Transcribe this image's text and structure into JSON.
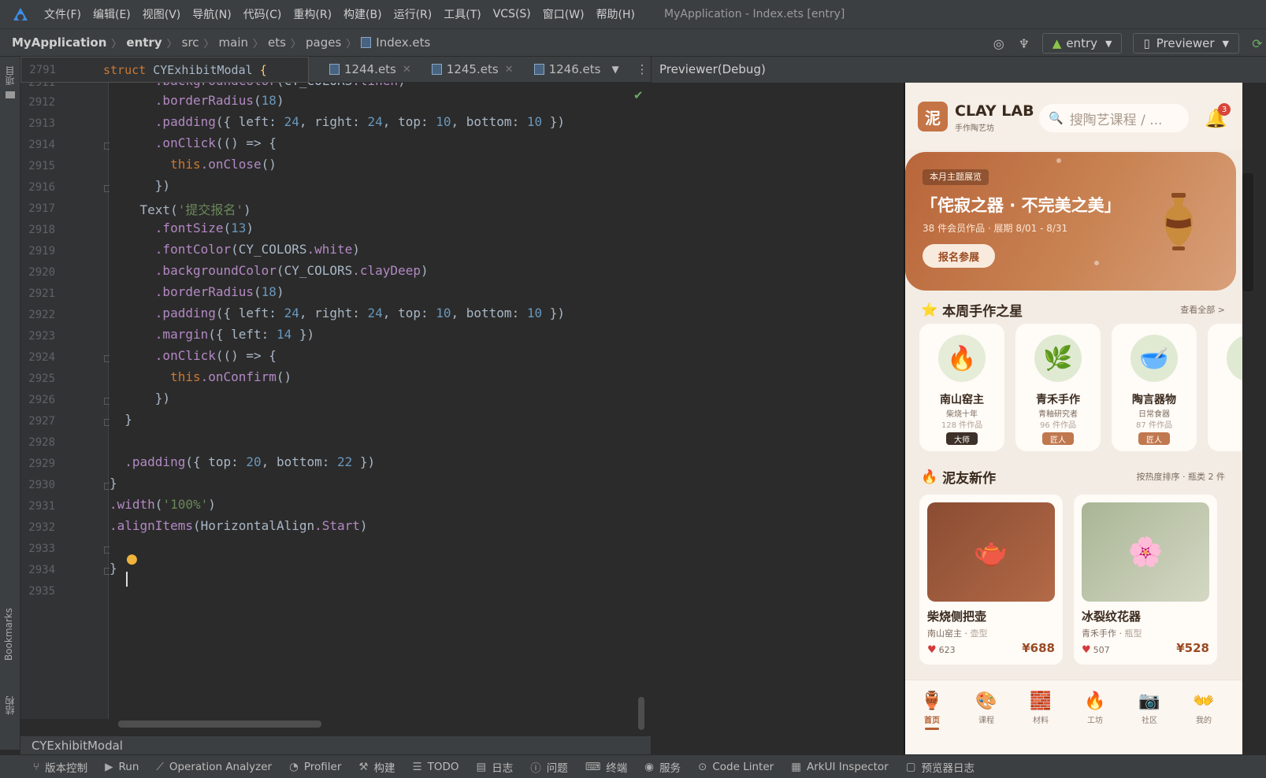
{
  "menubar": {
    "items": [
      "文件(F)",
      "编辑(E)",
      "视图(V)",
      "导航(N)",
      "代码(C)",
      "重构(R)",
      "构建(B)",
      "运行(R)",
      "工具(T)",
      "VCS(S)",
      "窗口(W)",
      "帮助(H)"
    ],
    "window_title": "MyApplication - Index.ets [entry]"
  },
  "breadcrumb": {
    "items": [
      "MyApplication",
      "entry",
      "src",
      "main",
      "ets",
      "pages",
      "Index.ets"
    ]
  },
  "toolbar": {
    "module": "entry",
    "previewer": "Previewer"
  },
  "left_tool_window": {
    "project": "项目",
    "bookmarks": "Bookmarks",
    "structure": "结构"
  },
  "editor_tabs": [
    "1244.ets",
    "1245.ets",
    "1246.ets"
  ],
  "sticky_header": {
    "line": "2791",
    "code": "struct CYExhibitModal {"
  },
  "editor": {
    "lines": [
      {
        "n": "2912",
        "code": "      .borderRadius(18)"
      },
      {
        "n": "2913",
        "code": "      .padding({ left: 24, right: 24, top: 10, bottom: 10 })"
      },
      {
        "n": "2914",
        "code": "      .onClick(() => {"
      },
      {
        "n": "2915",
        "code": "        this.onClose()"
      },
      {
        "n": "2916",
        "code": "      })"
      },
      {
        "n": "2917",
        "code": "    Text('提交报名')"
      },
      {
        "n": "2918",
        "code": "      .fontSize(13)"
      },
      {
        "n": "2919",
        "code": "      .fontColor(CY_COLORS.white)"
      },
      {
        "n": "2920",
        "code": "      .backgroundColor(CY_COLORS.clayDeep)"
      },
      {
        "n": "2921",
        "code": "      .borderRadius(18)"
      },
      {
        "n": "2922",
        "code": "      .padding({ left: 24, right: 24, top: 10, bottom: 10 })"
      },
      {
        "n": "2923",
        "code": "      .margin({ left: 14 })"
      },
      {
        "n": "2924",
        "code": "      .onClick(() => {"
      },
      {
        "n": "2925",
        "code": "        this.onConfirm()"
      },
      {
        "n": "2926",
        "code": "      })"
      },
      {
        "n": "2927",
        "code": "  }"
      },
      {
        "n": "2928",
        "code": ""
      },
      {
        "n": "2929",
        "code": "  .padding({ top: 20, bottom: 22 })"
      },
      {
        "n": "2930",
        "code": "}"
      },
      {
        "n": "2931",
        "code": ".width('100%')"
      },
      {
        "n": "2932",
        "code": ".alignItems(HorizontalAlign.Start)"
      },
      {
        "n": "2933",
        "code": ""
      },
      {
        "n": "2934",
        "code": "}"
      },
      {
        "n": "2935",
        "code": ""
      }
    ],
    "partial_top": {
      "n": "2911",
      "code": "      .backgroundColor(CY_COLORS.linen)"
    }
  },
  "structure_bar": "CYExhibitModal",
  "previewer_header": "Previewer(Debug)",
  "statusbar": [
    "版本控制",
    "Run",
    "Operation Analyzer",
    "Profiler",
    "构建",
    "TODO",
    "日志",
    "问题",
    "终端",
    "服务",
    "Code Linter",
    "ArkUI Inspector",
    "预览器日志"
  ],
  "phone": {
    "brand_mark": "泥",
    "brand_name": "CLAY LAB",
    "brand_sub": "手作陶艺坊",
    "search_placeholder": "搜陶艺课程 / ...",
    "notification_count": "3",
    "banner": {
      "tag": "本月主题展览",
      "title": "「侘寂之器 · 不完美之美」",
      "subtitle": "38 件会员作品 · 展期 8/01 - 8/31",
      "button": "报名参展"
    },
    "stars_section": {
      "title": "本周手作之星",
      "more": "查看全部 >"
    },
    "stars": [
      {
        "name": "南山窑主",
        "role": "柴烧十年",
        "works": "128 件作品",
        "badge": "大师",
        "badge_color": "#3e3129",
        "icon": "🔥"
      },
      {
        "name": "青禾手作",
        "role": "青釉研究者",
        "works": "96 件作品",
        "badge": "匠人",
        "badge_color": "#c0784f",
        "icon": "🌿"
      },
      {
        "name": "陶言器物",
        "role": "日常食器",
        "works": "87 件作品",
        "badge": "匠人",
        "badge_color": "#c0784f",
        "icon": "🥣"
      }
    ],
    "works_section": {
      "title": "泥友新作",
      "sort": "按热度排序 · 瓶类 2 件"
    },
    "works": [
      {
        "name": "柴烧侧把壶",
        "author": "南山窑主",
        "type": "壶型",
        "likes": "623",
        "price": "¥688",
        "icon": "🫖",
        "bg": "#9a5a3e"
      },
      {
        "name": "冰裂纹花器",
        "author": "青禾手作",
        "type": "瓶型",
        "likes": "507",
        "price": "¥528",
        "icon": "🌸",
        "bg": "#b8c2a4"
      }
    ],
    "tabs": [
      {
        "label": "首页",
        "icon": "🏺"
      },
      {
        "label": "课程",
        "icon": "🎨"
      },
      {
        "label": "材料",
        "icon": "🧱"
      },
      {
        "label": "工坊",
        "icon": "🔥"
      },
      {
        "label": "社区",
        "icon": "📷"
      },
      {
        "label": "我的",
        "icon": "👐"
      }
    ]
  }
}
